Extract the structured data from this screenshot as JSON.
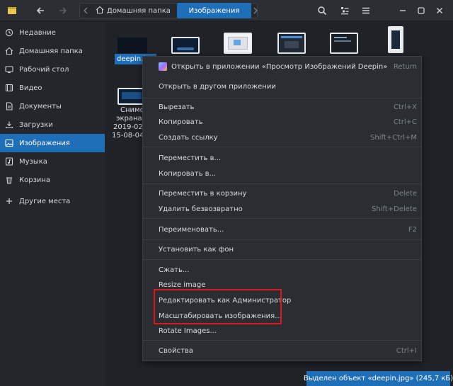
{
  "header": {
    "breadcrumb_home": "Домашняя папка",
    "breadcrumb_current": "Изображения"
  },
  "sidebar": {
    "items": [
      {
        "label": "Недавние",
        "icon": "clock-icon"
      },
      {
        "label": "Домашняя папка",
        "icon": "home-icon"
      },
      {
        "label": "Рабочий стол",
        "icon": "desktop-icon"
      },
      {
        "label": "Видео",
        "icon": "video-icon"
      },
      {
        "label": "Документы",
        "icon": "document-icon"
      },
      {
        "label": "Загрузки",
        "icon": "download-icon"
      },
      {
        "label": "Изображения",
        "icon": "image-icon",
        "active": true
      },
      {
        "label": "Музыка",
        "icon": "music-icon"
      },
      {
        "label": "Корзина",
        "icon": "trash-icon"
      },
      {
        "label": "Другие места",
        "icon": "plus-icon"
      }
    ]
  },
  "files": {
    "selected_name": "deepin.jpg",
    "screenshot_label_lines": [
      "Снимо",
      "экрана",
      "2019-02-",
      "15-08-04."
    ]
  },
  "menu": {
    "open_with_app": "Открыть в приложении «Просмотр Изображений Deepin»",
    "open_with_app_key": "Return",
    "open_other": "Открыть в другом приложении",
    "cut": "Вырезать",
    "cut_key": "Ctrl+X",
    "copy": "Копировать",
    "copy_key": "Ctrl+C",
    "link": "Создать ссылку",
    "link_key": "Shift+Ctrl+M",
    "move_to": "Переместить в...",
    "copy_to": "Копировать в...",
    "trash": "Переместить в корзину",
    "trash_key": "Delete",
    "delete": "Удалить безвозвратно",
    "delete_key": "Shift+Delete",
    "rename": "Переименовать...",
    "rename_key": "F2",
    "wallpaper": "Установить как фон",
    "compress": "Сжать...",
    "resize": "Resize image",
    "edit_admin": "Редактировать как Администратор",
    "scale": "Масштабировать изображения...",
    "rotate": "Rotate Images...",
    "properties": "Свойства",
    "properties_key": "Ctrl+I"
  },
  "status": {
    "text": "Выделен объект «deepin.jpg» (245,7 кБ)"
  },
  "colors": {
    "accent": "#1f6fb8",
    "highlight_box": "#e0161b",
    "background": "#1f2327"
  }
}
